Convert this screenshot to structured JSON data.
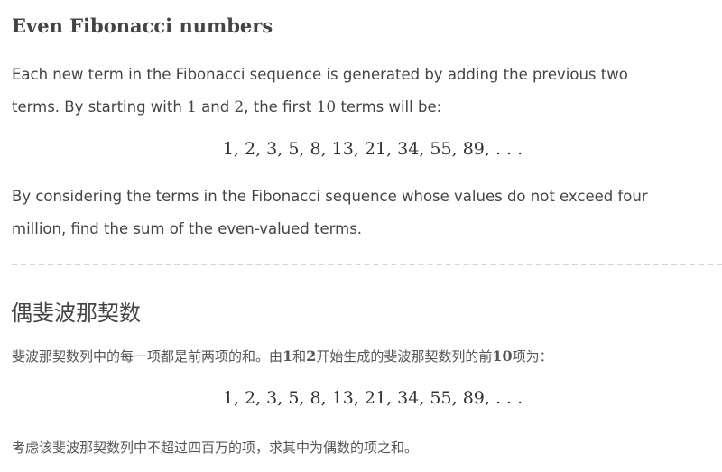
{
  "english": {
    "title": "Even Fibonacci numbers",
    "para1": {
      "line1": "Each new term in the Fibonacci sequence is generated by adding the previous two",
      "line2_a": "terms. By starting with ",
      "n1": "1",
      "line2_b": " and ",
      "n2": "2",
      "line2_c": ", the first ",
      "n10": "10",
      "line2_d": " terms will be:"
    },
    "sequence": "1, 2, 3, 5, 8, 13, 21, 34, 55, 89, . . .",
    "para2": {
      "line1": "By considering the terms in the Fibonacci sequence whose values do not exceed four",
      "line2": "million, find the sum of the even-valued terms."
    }
  },
  "chinese": {
    "title": "偶斐波那契数",
    "para1": {
      "a": "斐波那契数列中的每一项都是前两项的和。由",
      "n1": "1",
      "b": "和",
      "n2": "2",
      "c": "开始生成的斐波那契数列的前",
      "n10": "10",
      "d": "项为："
    },
    "sequence": "1, 2, 3, 5, 8, 13, 21, 34, 55, 89, . . .",
    "para2": "考虑该斐波那契数列中不超过四百万的项，求其中为偶数的项之和。"
  }
}
